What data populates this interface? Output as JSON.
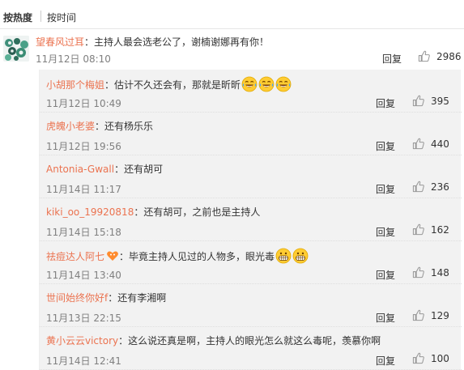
{
  "sort": {
    "hot": "按热度",
    "time": "按时间"
  },
  "main_comment": {
    "user": "望春风过耳",
    "text": "：主持人最会选老公了，谢楠谢娜再有你！",
    "time": "11月12日 08:10",
    "reply_label": "回复",
    "likes": "2986"
  },
  "replies": [
    {
      "user": "小胡那个梅姐",
      "text": "：估计不久还会有，那就是昕昕",
      "time": "11月12日 10:49",
      "reply_label": "回复",
      "likes": "395",
      "emoji": [
        "laugh-cry-emoji",
        "laugh-cry-emoji",
        "laugh-cry-emoji"
      ]
    },
    {
      "user": "虎魄小老婆",
      "text": "：还有杨乐乐",
      "time": "11月12日 19:56",
      "reply_label": "回复",
      "likes": "440"
    },
    {
      "user": "Antonia-Gwall",
      "text": "：还有胡可",
      "time": "11月14日 11:17",
      "reply_label": "回复",
      "likes": "236"
    },
    {
      "user": "kiki_oo_19920818",
      "text": "：还有胡可，之前也是主持人",
      "time": "11月14日 15:18",
      "reply_label": "回复",
      "likes": "162"
    },
    {
      "user": "祛痘达人阿七",
      "text": "：毕竟主持人见过的人物多，眼光毒",
      "time": "11月14日 13:40",
      "reply_label": "回复",
      "likes": "148",
      "badge": "heart-badge-icon",
      "emoji": [
        "grin-emoji",
        "grin-emoji"
      ]
    },
    {
      "user": "世间始终你好f",
      "text": "：还有李湘啊",
      "time": "11月13日 22:15",
      "reply_label": "回复",
      "likes": "129"
    },
    {
      "user": "黄小云云victory",
      "text": "：这么说还真是啊，主持人的眼光怎么就这么毒呢，羡慕你啊",
      "time": "11月14日 12:41",
      "reply_label": "回复",
      "likes": "100"
    }
  ],
  "icons": {
    "like": "thumbs-up-icon",
    "avatar": "green-pattern-avatar"
  },
  "colors": {
    "username": "#eb7350",
    "meta": "#808080",
    "reply_bg": "#f2f2f2",
    "like_icon": "#999999"
  }
}
